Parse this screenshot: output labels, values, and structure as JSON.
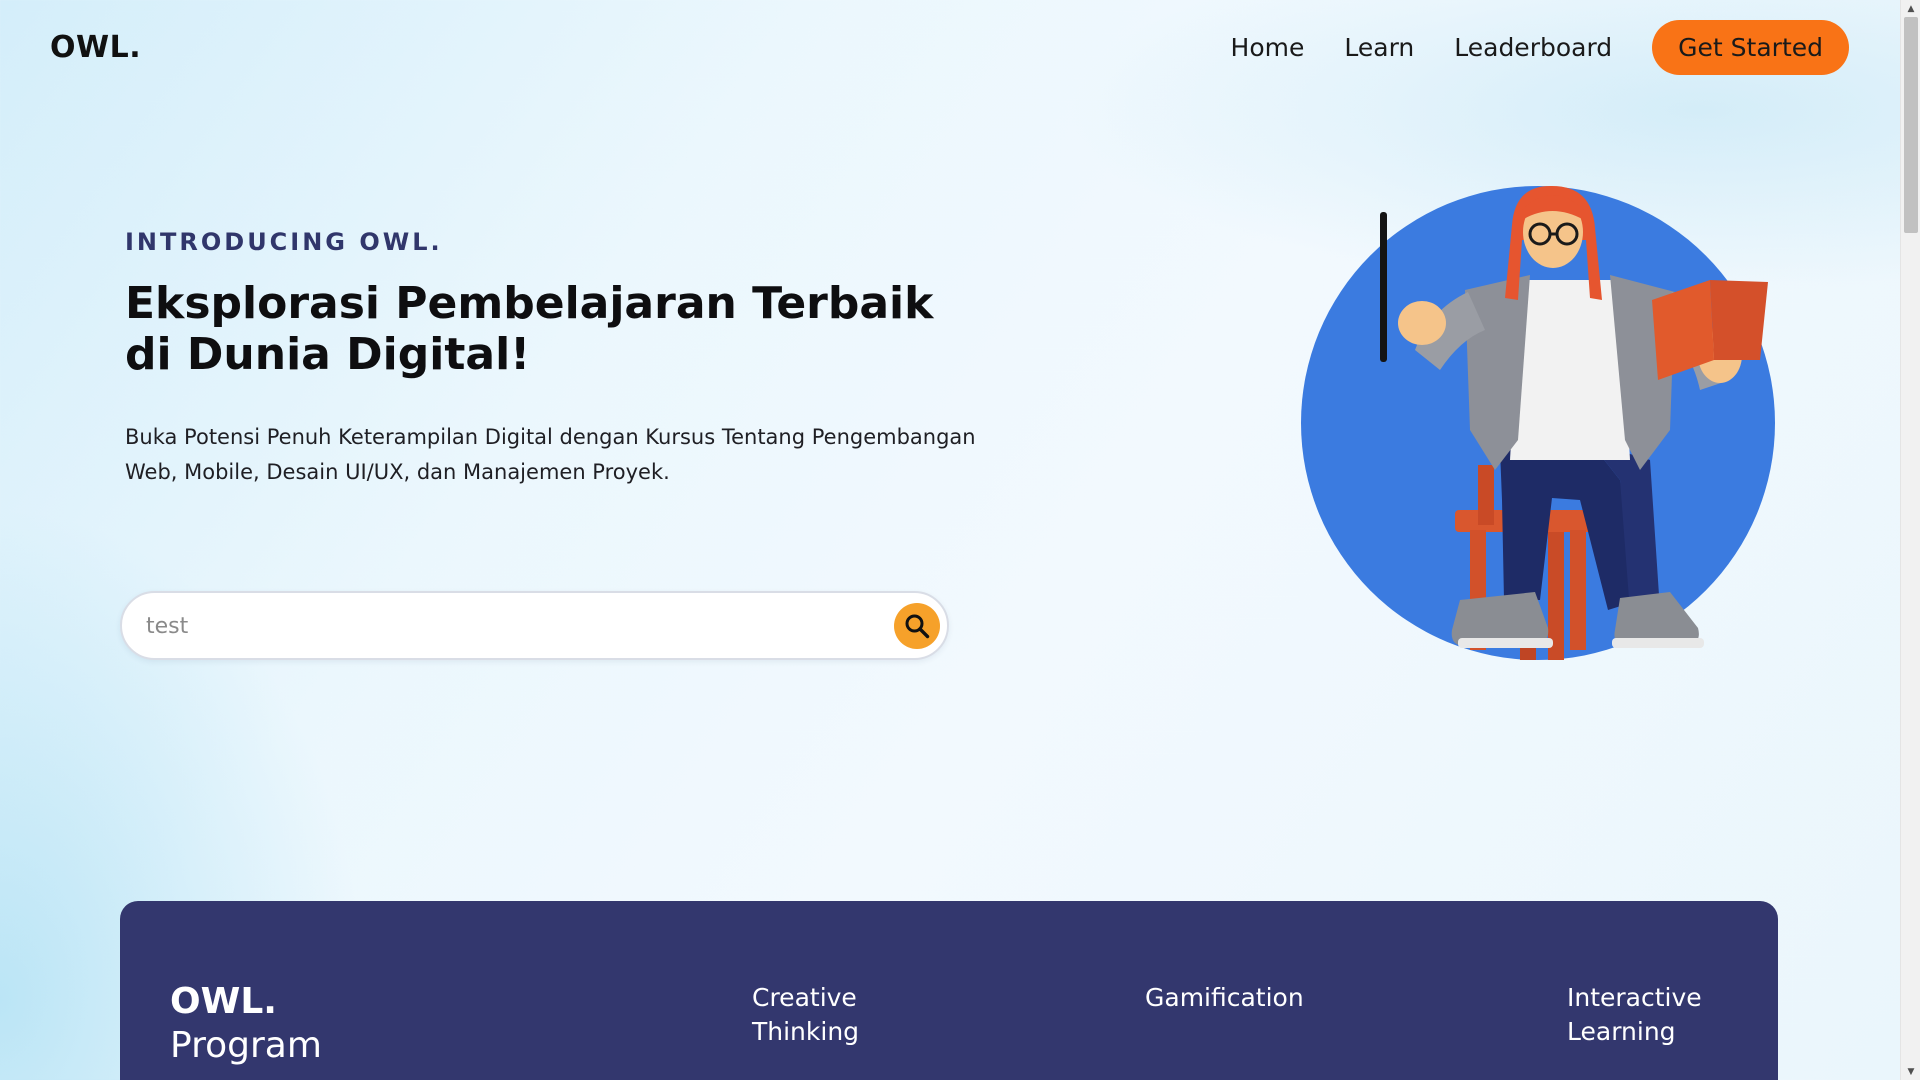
{
  "nav": {
    "logo": "OWL.",
    "links": [
      "Home",
      "Learn",
      "Leaderboard"
    ],
    "cta": "Get Started"
  },
  "hero": {
    "eyebrow": "INTRODUCING OWL.",
    "title": "Eksplorasi Pembelajaran Terbaik di Dunia Digital!",
    "description": "Buka Potensi Penuh Keterampilan Digital dengan Kursus Tentang Pengembangan Web, Mobile, Desain UI/UX, dan Manajemen Proyek.",
    "search": {
      "value": "test",
      "placeholder": "",
      "button_icon": "search-icon"
    },
    "illustration_icon": "teacher-illustration"
  },
  "program": {
    "logo": "OWL.",
    "subtitle": "Program",
    "features": [
      "Creative Thinking",
      "Gamification",
      "Interactive Learning"
    ]
  },
  "colors": {
    "accent": "#f97316",
    "search_button": "#f6a12a",
    "card_bg": "#33376e",
    "eyebrow": "#30366b",
    "circle": "#3b7be0"
  },
  "scrollbar": {
    "up_icon": "scroll-up-arrow-icon",
    "down_icon": "scroll-down-arrow-icon"
  }
}
